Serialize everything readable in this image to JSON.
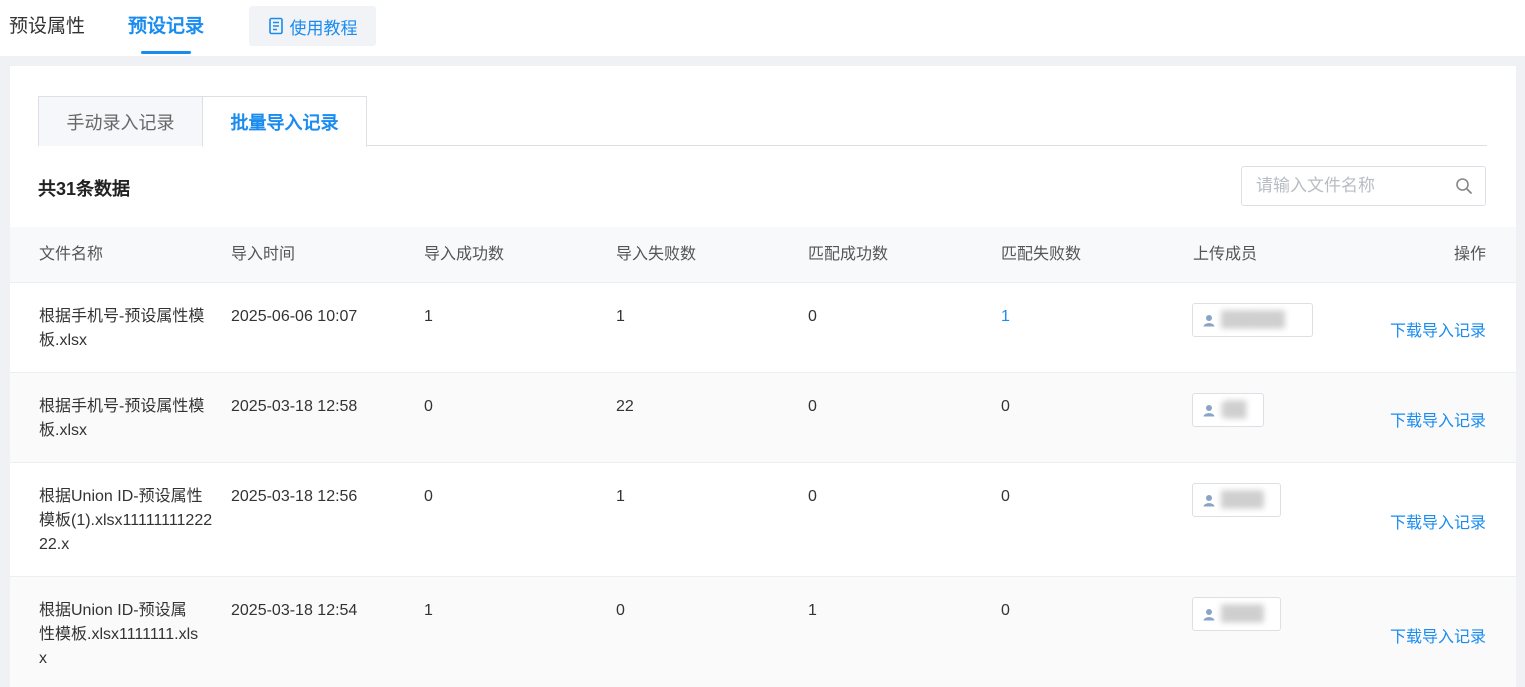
{
  "top_tabs": [
    "预设属性",
    "预设记录"
  ],
  "tutorial_label": "使用教程",
  "sub_tabs": [
    "手动录入记录",
    "批量导入记录"
  ],
  "total_text": "共31条数据",
  "search": {
    "placeholder": "请输入文件名称",
    "value": ""
  },
  "columns": [
    "文件名称",
    "导入时间",
    "导入成功数",
    "导入失败数",
    "匹配成功数",
    "匹配失败数",
    "上传成员",
    "操作"
  ],
  "rows": [
    {
      "file": "根据手机号-预设属性模板.xlsx",
      "time": "2025-06-06 10:07",
      "import_success": "1",
      "import_fail": "1",
      "match_success": "0",
      "match_fail": "1",
      "member": "██████",
      "action": "下载导入记录"
    },
    {
      "file": "根据手机号-预设属性模板.xlsx",
      "time": "2025-03-18 12:58",
      "import_success": "0",
      "import_fail": "22",
      "match_success": "0",
      "match_fail": "0",
      "member": "/██",
      "action": "下载导入记录"
    },
    {
      "file": "根据Union ID-预设属性模板(1).xlsx1111111122222.x",
      "time": "2025-03-18 12:56",
      "import_success": "0",
      "import_fail": "1",
      "match_success": "0",
      "match_fail": "0",
      "member": "████",
      "action": "下载导入记录"
    },
    {
      "file": "根据Union ID-预设属性模板.xlsx1111111.xlsx",
      "time": "2025-03-18 12:54",
      "import_success": "1",
      "import_fail": "0",
      "match_success": "1",
      "match_fail": "0",
      "member": "████",
      "action": "下载导入记录"
    }
  ],
  "colors": {
    "accent": "#1a8cf0",
    "border": "#dcdfe6",
    "header_bg": "#f8f9fb"
  }
}
